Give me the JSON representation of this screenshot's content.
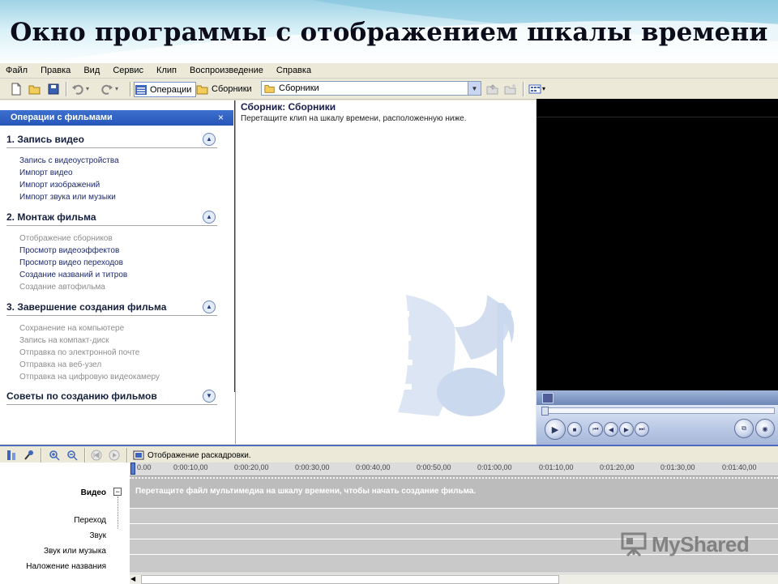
{
  "slide": {
    "title": "Окно программы с отображением шкалы времени"
  },
  "menu": [
    "Файл",
    "Правка",
    "Вид",
    "Сервис",
    "Клип",
    "Воспроизведение",
    "Справка"
  ],
  "toolbar": {
    "operations_label": "Операции",
    "collections_label": "Сборники",
    "collection_value": "Сборники"
  },
  "task_pane": {
    "header": "Операции с фильмами",
    "close_glyph": "×",
    "sections": [
      {
        "title": "1. Запись видео",
        "tasks": [
          {
            "label": "Запись с видеоустройства",
            "enabled": true
          },
          {
            "label": "Импорт видео",
            "enabled": true
          },
          {
            "label": "Импорт изображений",
            "enabled": true
          },
          {
            "label": "Импорт звука или музыки",
            "enabled": true
          }
        ]
      },
      {
        "title": "2. Монтаж фильма",
        "tasks": [
          {
            "label": "Отображение сборников",
            "enabled": false
          },
          {
            "label": "Просмотр видеоэффектов",
            "enabled": true
          },
          {
            "label": "Просмотр видео переходов",
            "enabled": true
          },
          {
            "label": "Создание названий и титров",
            "enabled": true
          },
          {
            "label": "Создание автофильма",
            "enabled": false
          }
        ]
      },
      {
        "title": "3. Завершение создания фильма",
        "tasks": [
          {
            "label": "Сохранение на компьютере",
            "enabled": false
          },
          {
            "label": "Запись на компакт-диск",
            "enabled": false
          },
          {
            "label": "Отправка по электронной почте",
            "enabled": false
          },
          {
            "label": "Отправка на веб-узел",
            "enabled": false
          },
          {
            "label": "Отправка на цифровую видеокамеру",
            "enabled": false
          }
        ]
      },
      {
        "title": "Советы по созданию фильмов",
        "tasks": []
      }
    ]
  },
  "collection": {
    "title": "Сборник: Сборники",
    "hint": "Перетащите клип на шкалу времени, расположенную ниже."
  },
  "timeline": {
    "storyboard_label": "Отображение раскадровки.",
    "ruler": [
      "0.00",
      "0:00:10,00",
      "0:00:20,00",
      "0:00:30,00",
      "0:00:40,00",
      "0:00:50,00",
      "0:01:00,00",
      "0:01:10,00",
      "0:01:20,00",
      "0:01:30,00",
      "0:01:40,00"
    ],
    "tracks": {
      "video": "Видео",
      "transition": "Переход",
      "audio": "Звук",
      "audio_music": "Звук или музыка",
      "title_overlay": "Наложение названия"
    },
    "video_hint": "Перетащите файл мультимедиа на шкалу времени, чтобы начать создание фильма."
  },
  "watermark": "MyShared",
  "colors": {
    "taskpane_header": "#2f5fc4",
    "accent": "#4f6bbd",
    "preview_bg": "#000000"
  }
}
